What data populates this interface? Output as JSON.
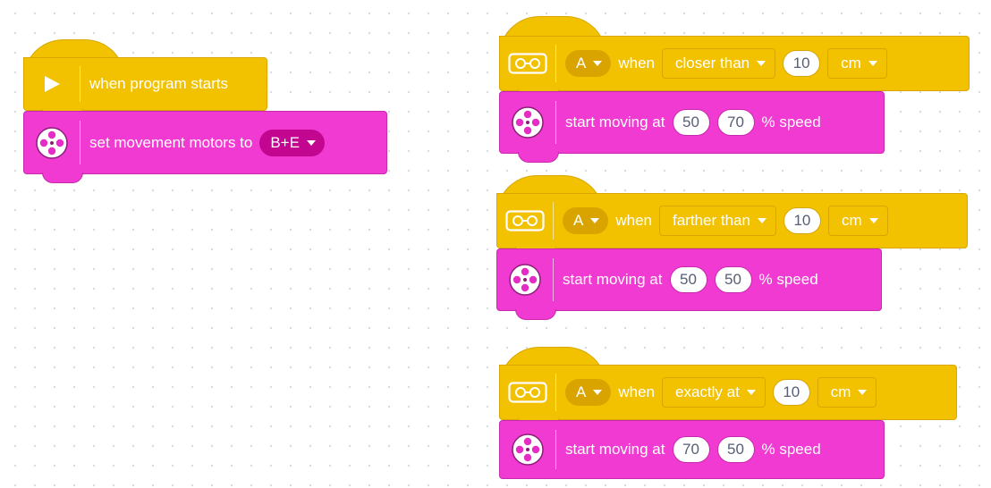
{
  "left_script": {
    "hat_label": "when program starts",
    "stack_label": "set movement motors to",
    "motors": "B+E"
  },
  "event_scripts": [
    {
      "port": "A",
      "when": "when",
      "comparison": "closer than",
      "distance": "10",
      "unit": "cm",
      "action": "start moving at",
      "speed_left": "50",
      "speed_right": "70",
      "speed_suffix": "% speed"
    },
    {
      "port": "A",
      "when": "when",
      "comparison": "farther than",
      "distance": "10",
      "unit": "cm",
      "action": "start moving at",
      "speed_left": "50",
      "speed_right": "50",
      "speed_suffix": "% speed"
    },
    {
      "port": "A",
      "when": "when",
      "comparison": "exactly at",
      "distance": "10",
      "unit": "cm",
      "action": "start moving at",
      "speed_left": "70",
      "speed_right": "50",
      "speed_suffix": "% speed"
    }
  ],
  "colors": {
    "event_yellow": "#f2c100",
    "movement_pink": "#f03ad1",
    "canvas": "#ffffff"
  },
  "icons": {
    "hat_left": "play-triangle-icon",
    "movement": "movement-wheel-icon",
    "sensor": "distance-sensor-icon"
  }
}
